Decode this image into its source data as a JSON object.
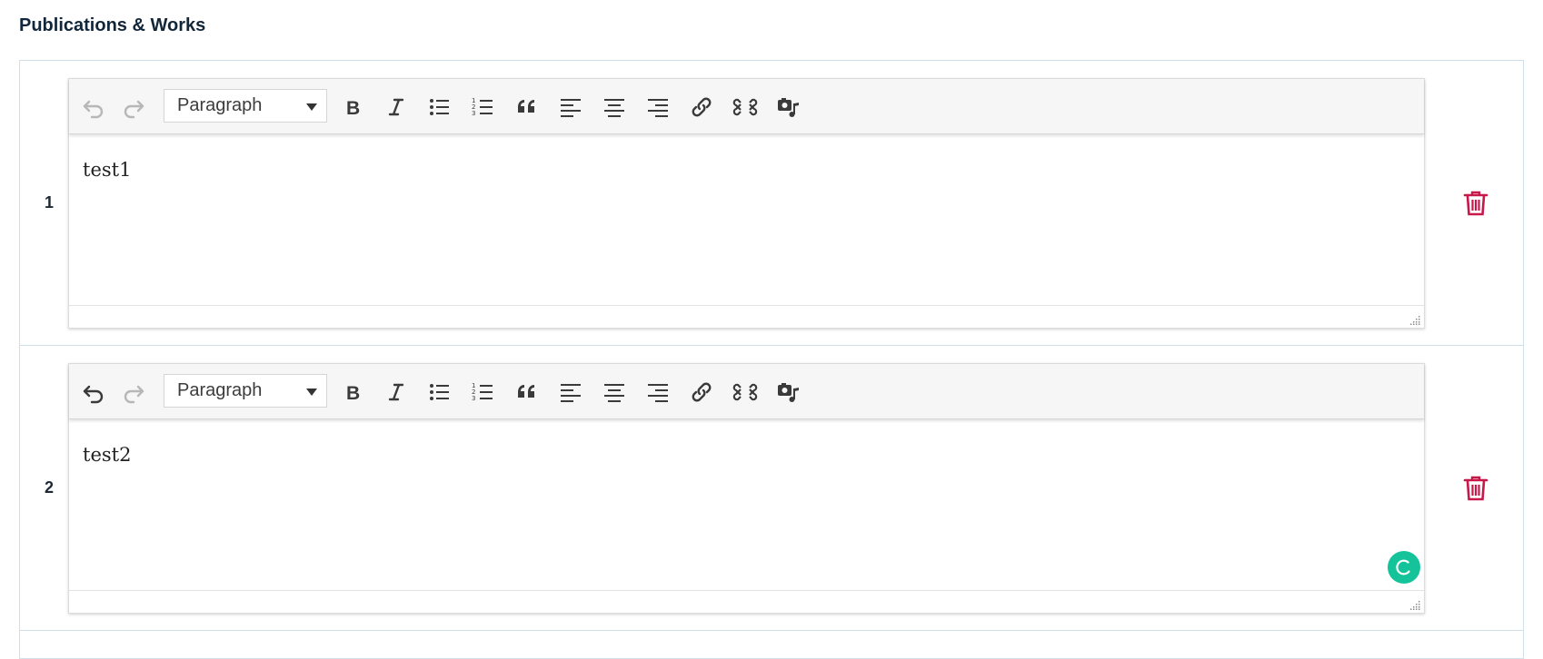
{
  "section": {
    "title": "Publications & Works"
  },
  "toolbar": {
    "format_value": "Paragraph",
    "icons": [
      "undo-icon",
      "redo-icon",
      "bold-icon",
      "italic-icon",
      "bullet-list-icon",
      "numbered-list-icon",
      "blockquote-icon",
      "align-left-icon",
      "align-center-icon",
      "align-right-icon",
      "link-icon",
      "unlink-icon",
      "media-icon"
    ]
  },
  "colors": {
    "delete": "#c8184a",
    "toolbar_bg": "#f5f6f5",
    "border": "#cfe0ea",
    "grammar_badge": "#15c39a"
  },
  "rows": [
    {
      "index": "1",
      "content": "test1",
      "undo_enabled": false
    },
    {
      "index": "2",
      "content": "test2",
      "undo_enabled": true
    }
  ]
}
